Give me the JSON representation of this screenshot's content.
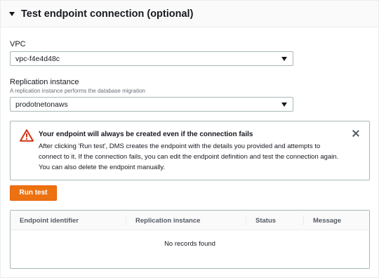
{
  "section": {
    "title": "Test endpoint connection (optional)"
  },
  "vpc": {
    "label": "VPC",
    "value": "vpc-f4e4d48c"
  },
  "replication": {
    "label": "Replication instance",
    "description": "A replication instance performs the database migration",
    "value": "prodotnetonaws"
  },
  "alert": {
    "title": "Your endpoint will always be created even if the connection fails",
    "body": "After clicking 'Run test', DMS creates the endpoint with the details you provided and attempts to connect to it. If the connection fails, you can edit the endpoint definition and test the connection again. You can also delete the endpoint manually."
  },
  "run_test": {
    "label": "Run test"
  },
  "table": {
    "columns": [
      "Endpoint identifier",
      "Replication instance",
      "Status",
      "Message"
    ],
    "empty_text": "No records found"
  },
  "colors": {
    "accent": "#ec7211",
    "warning": "#d13212",
    "border": "#aab7b8",
    "text": "#16191f",
    "muted": "#687078"
  }
}
